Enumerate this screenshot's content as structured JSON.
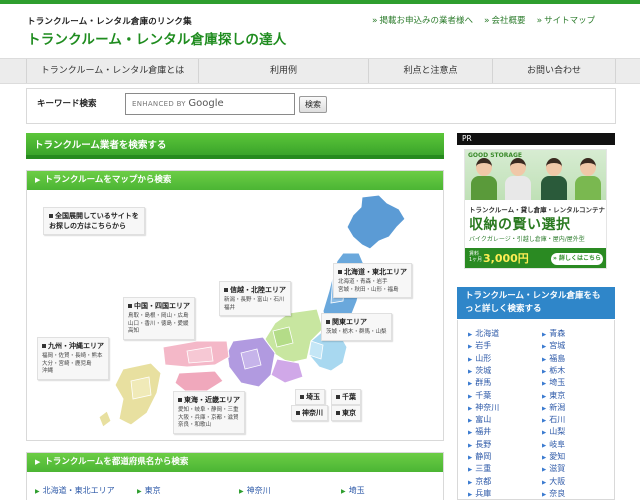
{
  "header": {
    "tagline": "トランクルーム・レンタル倉庫のリンク集",
    "title": "トランクルーム・レンタル倉庫探しの達人",
    "links": [
      "掲載お申込みの業者様へ",
      "会社概要",
      "サイトマップ"
    ],
    "link_arrow": "»"
  },
  "nav": {
    "items": [
      "トランクルーム・レンタル倉庫とは",
      "利用例",
      "利点と注意点",
      "お問い合わせ"
    ]
  },
  "search": {
    "label": "キーワード検索",
    "placeholder_prefix": "ENHANCED BY",
    "placeholder_brand": "Google",
    "button": "検索"
  },
  "main": {
    "heading": "トランクルーム業者を検索する",
    "map_heading": "トランクルームをマップから検索",
    "nationwide": [
      "全国展開しているサイトを",
      "お探しの方はこちらから"
    ],
    "regions": [
      {
        "title": "北海道・東北エリア",
        "lines": [
          "北海道・青森・岩手",
          "宮城・秋田・山形・福島"
        ]
      },
      {
        "title": "信越・北陸エリア",
        "lines": [
          "新潟・長野・富山・石川",
          "福井"
        ]
      },
      {
        "title": "中国・四国エリア",
        "lines": [
          "鳥取・島根・岡山・広島",
          "山口・香川・徳島・愛媛",
          "高知"
        ]
      },
      {
        "title": "関東エリア",
        "lines": [
          "茨城・栃木・群馬・山梨"
        ]
      },
      {
        "title": "九州・沖縄エリア",
        "lines": [
          "福岡・佐賀・長崎・熊本",
          "大分・宮崎・鹿児島",
          "沖縄"
        ]
      },
      {
        "title": "東海・近畿エリア",
        "lines": [
          "愛知・岐阜・静岡・三重",
          "大阪・兵庫・京都・滋賀",
          "奈良・和歌山"
        ]
      }
    ],
    "cities": [
      "埼玉",
      "千葉",
      "神奈川",
      "東京"
    ],
    "pref_heading": "トランクルームを都道府県名から検索",
    "pref_row": [
      "北海道・東北エリア",
      "東京",
      "神奈川",
      "埼玉"
    ]
  },
  "sidebar": {
    "pr_label": "PR",
    "ad": {
      "brand": "GOOD STORAGE",
      "copy1": "トランクルーム・貸し倉庫・レンタルコンテナ",
      "copy2": "収納の賢い選択",
      "copy3": "バイクガレージ・引越し倉庫・屋内/屋外型",
      "price_tag": [
        "賃料",
        "1ヶ月"
      ],
      "price": "3,000円",
      "cta": "» 詳しくはこちら"
    },
    "region_heading": "トランクルーム・レンタル倉庫をもっと詳しく検索する",
    "prefectures_left": [
      "北海道",
      "岩手",
      "山形",
      "茨城",
      "群馬",
      "千葉",
      "神奈川",
      "富山",
      "福井",
      "長野",
      "静岡",
      "三重",
      "京都",
      "兵庫"
    ],
    "prefectures_right": [
      "青森",
      "宮城",
      "福島",
      "栃木",
      "埼玉",
      "東京",
      "新潟",
      "石川",
      "山梨",
      "岐阜",
      "愛知",
      "滋賀",
      "大阪",
      "奈良"
    ]
  },
  "colors": {
    "brand_green": "#2e9e2e",
    "heading_green": "#3aa42a",
    "link_blue": "#2e5aa8",
    "side_blue": "#2f86c9",
    "map_hokkaido_tohoku": "#5b9bd5",
    "map_kanto": "#a8d8f0",
    "map_chubu": "#c8e6a0",
    "map_kinki_tokai": "#b19ae0",
    "map_chugoku_shikoku": "#f4b8c8",
    "map_kyushu": "#e8e0a0"
  }
}
